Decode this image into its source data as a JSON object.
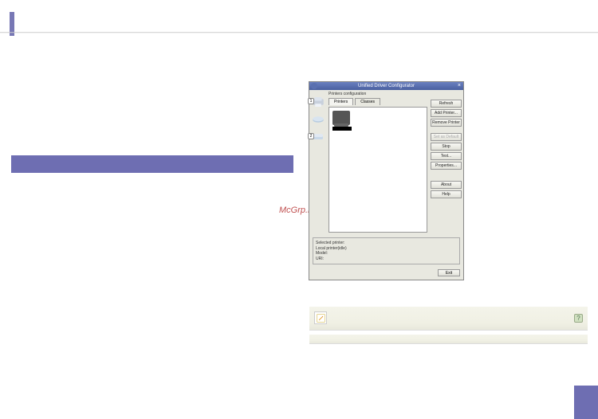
{
  "watermark": "McGrp.Ru",
  "window": {
    "title": "Unified Driver Configurator",
    "sectionLabel": "Printers configuration",
    "tabs": {
      "printers": "Printers",
      "classes": "Classes"
    },
    "rail": {
      "badge1": "1",
      "badge2": "2"
    },
    "buttons": {
      "refresh": "Refresh",
      "addPrinter": "Add Printer...",
      "removePrinter": "Remove Printer",
      "setDefault": "Set as Default",
      "stop": "Stop",
      "test": "Test...",
      "properties": "Properties...",
      "about": "About",
      "help": "Help",
      "exit": "Exit"
    },
    "info": {
      "header": "Selected printer:",
      "line1": "Local printer(idle)",
      "line2": "Model:",
      "line3": "URI:"
    }
  },
  "help": {
    "q": "?"
  }
}
